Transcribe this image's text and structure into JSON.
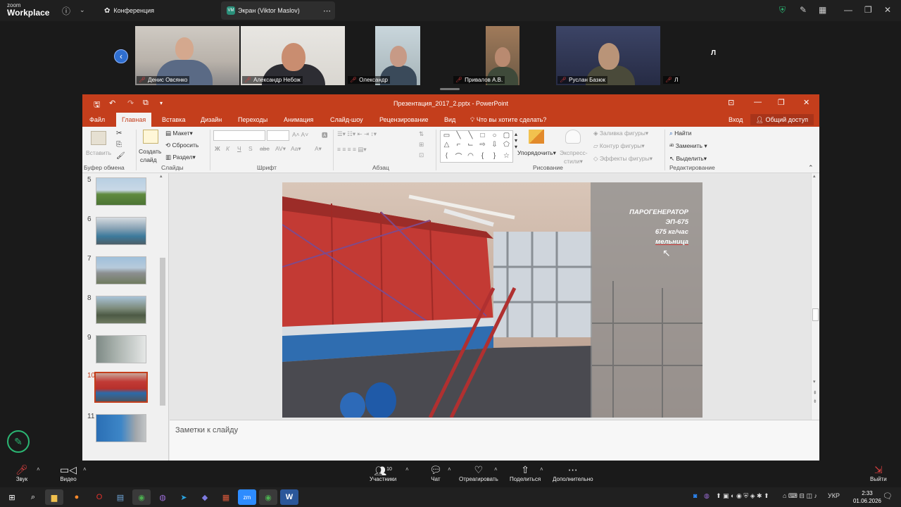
{
  "zoom_top": {
    "logo_small": "zoom",
    "logo_big": "Workplace",
    "tab_conference": "Конференция",
    "tab_screen": "Экран (Viktor Maslov)",
    "avatar_initials": "VM"
  },
  "participants": [
    {
      "name": "Денис Овсянко"
    },
    {
      "name": "Александр Небож"
    },
    {
      "name": "Олександр"
    },
    {
      "name": "Привалов А.В."
    },
    {
      "name": "Руслан Базюк"
    },
    {
      "name": "Л"
    }
  ],
  "lone_participant_letter": "Л",
  "ppt": {
    "title": "Презентация_2017_2.pptx - PowerPoint",
    "tabs": [
      "Файл",
      "Главная",
      "Вставка",
      "Дизайн",
      "Переходы",
      "Анимация",
      "Слайд-шоу",
      "Рецензирование",
      "Вид"
    ],
    "active_tab": "Главная",
    "tell_me": "Что вы хотите сделать?",
    "signin": "Вход",
    "share": "Общий доступ",
    "ribbon": {
      "paste": "Вставить",
      "clipboard_label": "Буфер обмена",
      "create_slide_1": "Создать",
      "create_slide_2": "слайд",
      "layout": "Макет",
      "reset": "Сбросить",
      "section": "Раздел",
      "slides_label": "Слайды",
      "font_label": "Шрифт",
      "paragraph_label": "Абзац",
      "arrange": "Упорядочить",
      "express_1": "Экспресс-",
      "express_2": "стили",
      "shape_fill": "Заливка фигуры",
      "shape_outline": "Контур фигуры",
      "shape_effects": "Эффекты фигуры",
      "drawing_label": "Рисование",
      "find": "Найти",
      "replace": "Заменить",
      "select": "Выделить",
      "editing_label": "Редактирование"
    },
    "slides": [
      {
        "num": "5"
      },
      {
        "num": "6"
      },
      {
        "num": "7"
      },
      {
        "num": "8"
      },
      {
        "num": "9"
      },
      {
        "num": "10"
      },
      {
        "num": "11"
      }
    ],
    "current_slide": "10",
    "slide_text": {
      "line1": "ПАРОГЕНЕРАТОР",
      "line2": "ЭП-675",
      "line3": "675 кг/час",
      "line4": "мельница"
    },
    "notes_placeholder": "Заметки к слайду"
  },
  "zoom_bottom": {
    "audio": "Звук",
    "video": "Видео",
    "participants": "Участники",
    "participants_count": "10",
    "chat": "Чат",
    "react": "Отреагировать",
    "share": "Поделиться",
    "more": "Дополнительно",
    "leave": "Выйти"
  },
  "taskbar": {
    "lang": "УКР",
    "time": "2:33",
    "date": "01.06.2026"
  }
}
